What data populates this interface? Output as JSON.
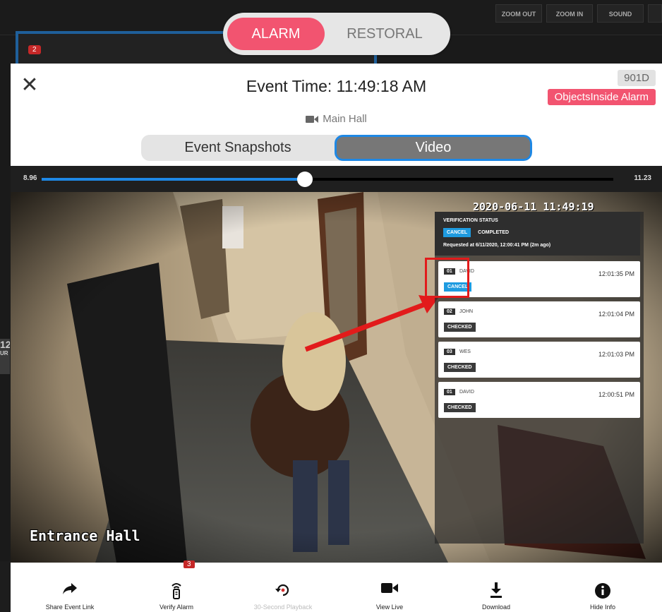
{
  "background": {
    "controls": [
      "ZOOM OUT",
      "ZOOM IN",
      "SOUND"
    ],
    "tile_badge": "2",
    "side_number": "12",
    "side_text": "UR",
    "bottom_badge": "3"
  },
  "mode_toggle": {
    "alarm": "ALARM",
    "restoral": "RESTORAL",
    "selected": "alarm"
  },
  "modal": {
    "close_glyph": "✕",
    "event_time": "Event Time: 11:49:18 AM",
    "camera_id": "901D",
    "alarm_type": "ObjectsInside Alarm",
    "camera_name": "Main Hall",
    "tabs": {
      "snapshots": "Event Snapshots",
      "video": "Video",
      "active": "video"
    }
  },
  "playback": {
    "start": "8.96",
    "end": "11.23",
    "progress": 0.46
  },
  "video": {
    "overlay_timestamp": "2020-06-11 11:49:19",
    "camera_label": "Entrance Hall"
  },
  "verification": {
    "title": "VERIFICATION STATUS",
    "status_chip": "CANCEL",
    "status_text": "COMPLETED",
    "requested": "Requested at 6/11/2020, 12:00:41 PM (2m ago)",
    "entries": [
      {
        "num": "01",
        "name": "DAVID",
        "time": "12:01:35 PM",
        "status": "CANCEL"
      },
      {
        "num": "02",
        "name": "JOHN",
        "time": "12:01:04 PM",
        "status": "CHECKED"
      },
      {
        "num": "03",
        "name": "WES",
        "time": "12:01:03 PM",
        "status": "CHECKED"
      },
      {
        "num": "01",
        "name": "DAVID",
        "time": "12:00:51 PM",
        "status": "CHECKED"
      }
    ]
  },
  "toolbar": {
    "share": "Share Event Link",
    "verify": "Verify Alarm",
    "playback": "30-Second Playback",
    "live": "View Live",
    "download": "Download",
    "info": "Hide Info"
  },
  "colors": {
    "alarm_pink": "#f25470",
    "accent_blue": "#1e88e5",
    "cancel_blue": "#1e9be0",
    "annotation_red": "#e21b1b"
  }
}
